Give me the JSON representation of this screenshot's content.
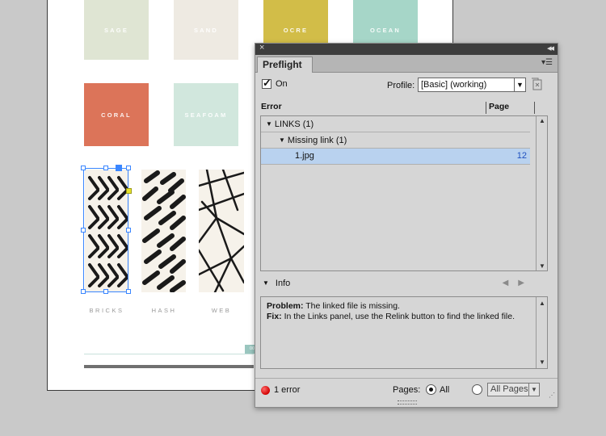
{
  "document": {
    "swatches": [
      {
        "label": "SAGE",
        "color": "#dfe5d3"
      },
      {
        "label": "SAND",
        "color": "#eeeae2"
      },
      {
        "label": "OCRE",
        "color": "#d2bd48"
      },
      {
        "label": "OCEAN",
        "color": "#a6d6c8"
      },
      {
        "label": "CORAL",
        "color": "#dc7459"
      },
      {
        "label": "SEAFOAM",
        "color": "#d1e7dd"
      }
    ],
    "patterns": [
      {
        "label": "BRICKS"
      },
      {
        "label": "HASH"
      },
      {
        "label": "WEB"
      }
    ],
    "page_tag": "00"
  },
  "panel": {
    "title": "Preflight",
    "on_label": "On",
    "on_checked": true,
    "profile_label": "Profile:",
    "profile_value": "[Basic] (working)",
    "col_error": "Error",
    "col_page": "Page",
    "tree": [
      {
        "label": "LINKS (1)",
        "level": 0,
        "page": ""
      },
      {
        "label": "Missing link (1)",
        "level": 1,
        "page": ""
      },
      {
        "label": "1.jpg",
        "level": 2,
        "page": "12",
        "selected": true
      }
    ],
    "info_label": "Info",
    "info": {
      "problem_label": "Problem:",
      "problem_text": " The linked file is missing.",
      "fix_label": "Fix:",
      "fix_text": " In the Links panel, use the Relink button to find the linked file."
    },
    "footer": {
      "error_count": "1 error",
      "pages_label": "Pages:",
      "all_label": "All",
      "range_value": "All Pages",
      "selected_pages_option": "All"
    }
  }
}
